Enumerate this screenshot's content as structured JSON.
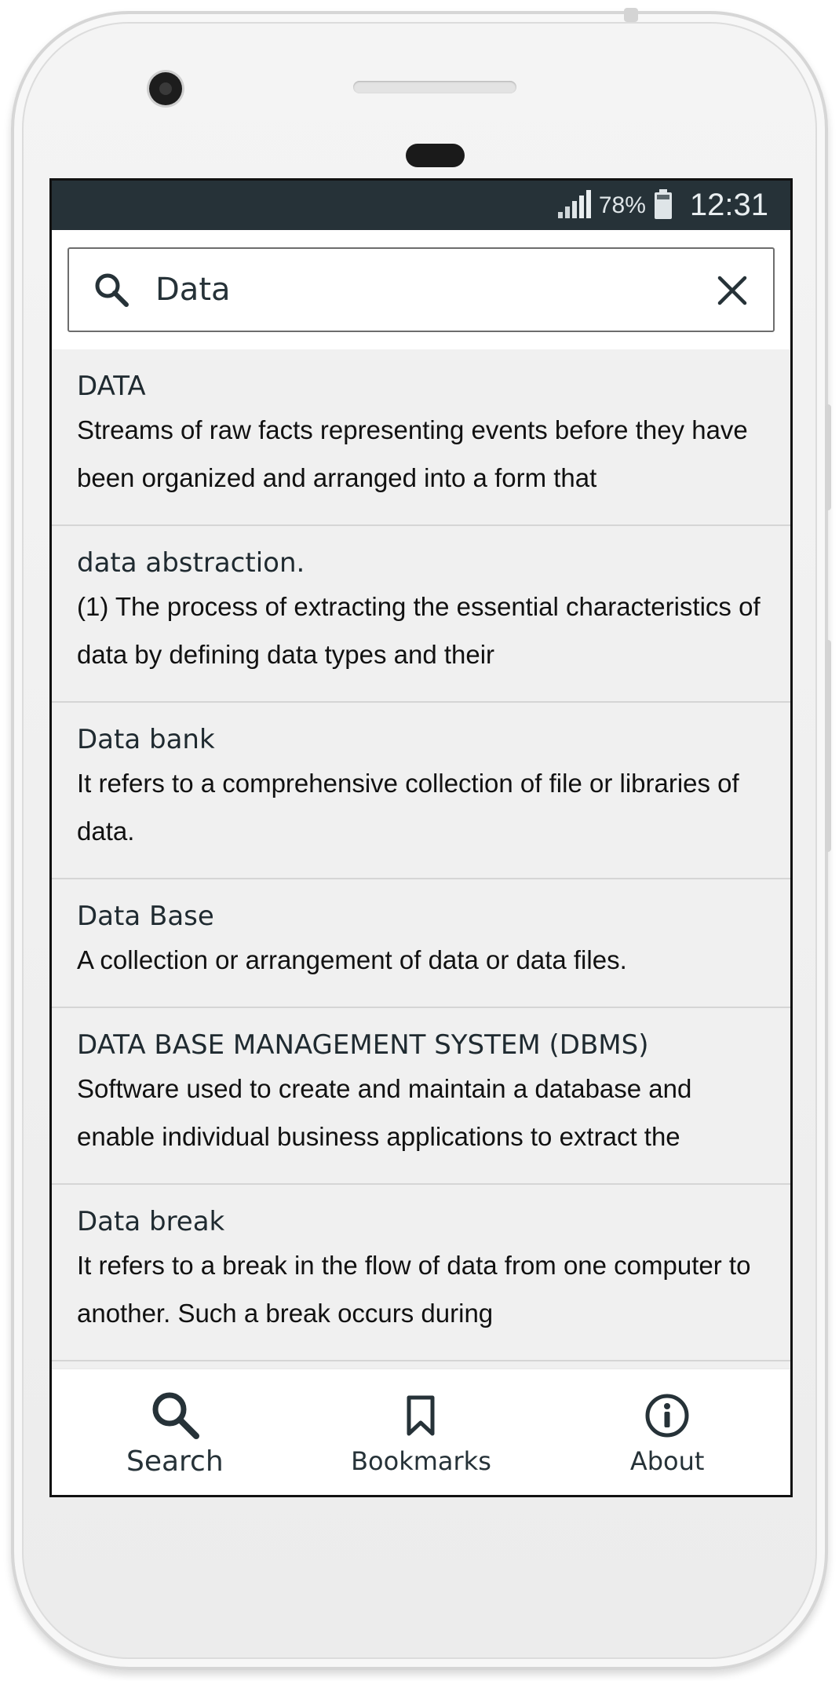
{
  "status_bar": {
    "battery": "78%",
    "time": "12:31",
    "icons": [
      "signal-icon",
      "battery-icon"
    ]
  },
  "search": {
    "value": "Data",
    "placeholder": "",
    "icon": "search-icon",
    "clear_icon": "close-icon"
  },
  "results": [
    {
      "term": "DATA",
      "definition": "Streams of raw facts representing events before they have been organized and arranged into a form that"
    },
    {
      "term": "data abstraction.",
      "definition": "(1) The process of extracting the essential characteristics of data by defining data types and their"
    },
    {
      "term": "Data bank",
      "definition": "It refers to a comprehensive collection of file or libraries of data."
    },
    {
      "term": "Data Base",
      "definition": "A collection or arrangement of data or data files."
    },
    {
      "term": "DATA BASE MANAGEMENT SYSTEM (DBMS)",
      "definition": "Software used to create and maintain a database and enable individual business applications to extract the"
    },
    {
      "term": "Data break",
      "definition": "It refers to a break in the flow of data from one computer to another. Such a break occurs during"
    }
  ],
  "nav": {
    "search_label": "Search",
    "bookmarks_label": "Bookmarks",
    "about_label": "About",
    "active": "Search"
  },
  "colors": {
    "status_bar": "#263238",
    "text_primary": "#263238",
    "list_background": "#f0f0f0"
  }
}
